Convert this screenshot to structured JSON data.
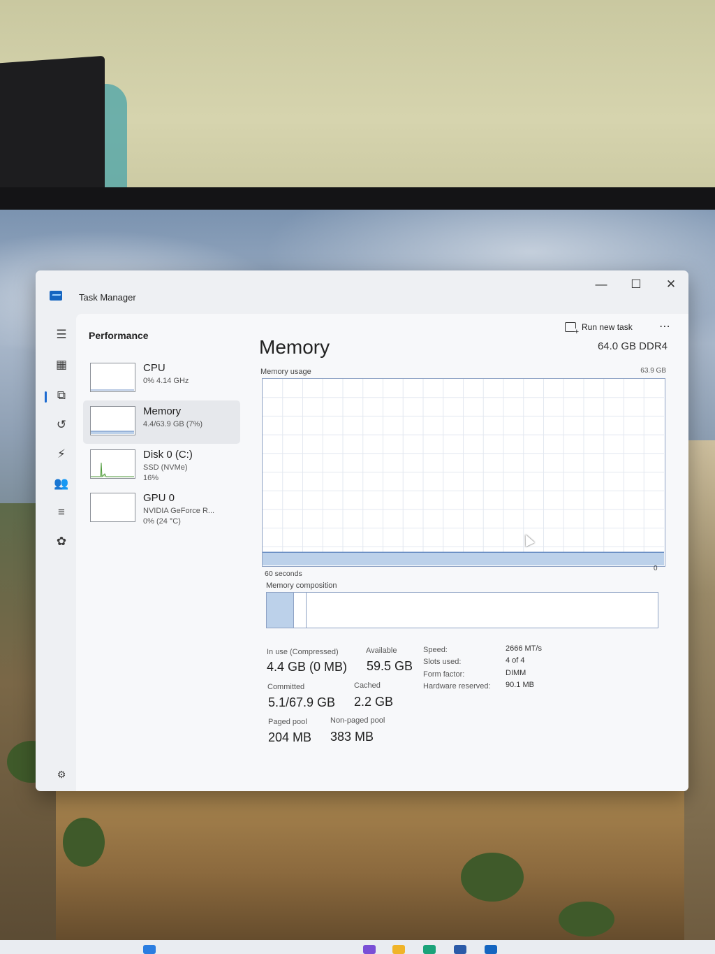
{
  "window": {
    "title": "Task Manager",
    "minimize_glyph": "—",
    "maximize_glyph": "☐",
    "close_glyph": "✕"
  },
  "header": {
    "page_title": "Performance",
    "run_new_task": "Run new task",
    "more_glyph": "⋯"
  },
  "nav_icons": [
    "hamburger-icon",
    "processes-icon",
    "performance-icon",
    "app-history-icon",
    "startup-apps-icon",
    "users-icon",
    "details-icon",
    "services-icon",
    "settings-icon"
  ],
  "resources": [
    {
      "name": "CPU",
      "line1": "0%  4.14 GHz",
      "line2": ""
    },
    {
      "name": "Memory",
      "line1": "4.4/63.9 GB (7%)",
      "line2": ""
    },
    {
      "name": "Disk 0 (C:)",
      "line1": "SSD (NVMe)",
      "line2": "16%"
    },
    {
      "name": "GPU 0",
      "line1": "NVIDIA GeForce R...",
      "line2": "0%  (24 °C)"
    }
  ],
  "memory": {
    "title": "Memory",
    "spec": "64.0 GB DDR4",
    "usage_label": "Memory usage",
    "usage_max": "63.9 GB",
    "axis_left": "60 seconds",
    "axis_right": "0",
    "composition_label": "Memory composition",
    "in_use_fraction": 0.07,
    "stats": {
      "in_use_label": "In use (Compressed)",
      "in_use_value": "4.4 GB (0 MB)",
      "available_label": "Available",
      "available_value": "59.5 GB",
      "committed_label": "Committed",
      "committed_value": "5.1/67.9 GB",
      "cached_label": "Cached",
      "cached_value": "2.2 GB",
      "paged_label": "Paged pool",
      "paged_value": "204 MB",
      "nonpaged_label": "Non-paged pool",
      "nonpaged_value": "383 MB"
    },
    "props": [
      {
        "key": "Speed:",
        "value": "2666 MT/s"
      },
      {
        "key": "Slots used:",
        "value": "4 of 4"
      },
      {
        "key": "Form factor:",
        "value": "DIMM"
      },
      {
        "key": "Hardware reserved:",
        "value": "90.1 MB"
      }
    ]
  },
  "colors": {
    "accent": "#1d6bd1",
    "graph_line": "#8ea2c4",
    "graph_fill": "#bcd1ea"
  }
}
